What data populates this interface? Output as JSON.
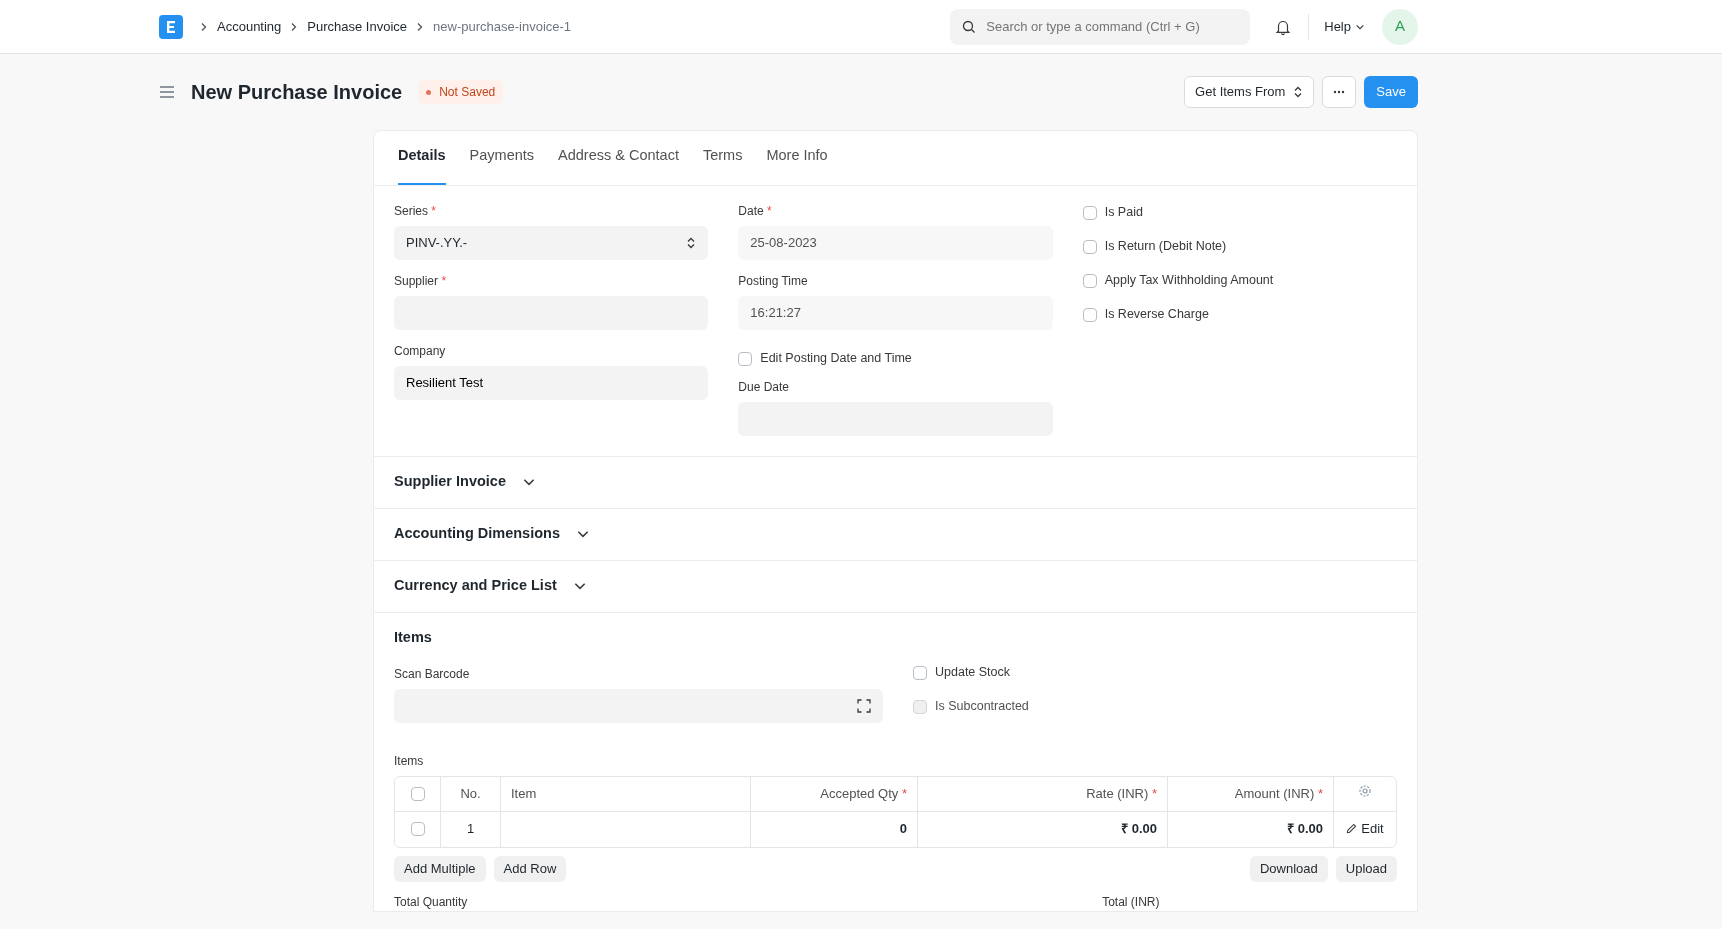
{
  "navbar": {
    "breadcrumbs": [
      "Accounting",
      "Purchase Invoice",
      "new-purchase-invoice-1"
    ],
    "search": {
      "placeholder": "Search or type a command (Ctrl + G)"
    },
    "help": "Help",
    "avatar": "A"
  },
  "page": {
    "title": "New Purchase Invoice",
    "indicator": {
      "label": "Not Saved",
      "color": "#e2725b"
    },
    "get_items": "Get Items From",
    "save": "Save"
  },
  "tabs": [
    {
      "label": "Details",
      "selected": true
    },
    {
      "label": "Payments",
      "selected": false
    },
    {
      "label": "Address & Contact",
      "selected": false
    },
    {
      "label": "Terms",
      "selected": false
    },
    {
      "label": "More Info",
      "selected": false
    }
  ],
  "columns": [
    [
      {
        "kind": "select",
        "label": "Series",
        "required_mark": "*",
        "value": "PINV-.YY.-"
      },
      {
        "kind": "input",
        "label": "Supplier",
        "required_mark": "*"
      },
      {
        "kind": "input",
        "label": "Company",
        "value": "Resilient Test"
      }
    ],
    [
      {
        "kind": "readonly",
        "label": "Date",
        "required_mark": "*",
        "value": "25-08-2023"
      },
      {
        "kind": "readonly",
        "label": "Posting Time",
        "value": "16:21:27"
      },
      {
        "kind": "checkbox",
        "label": "Edit Posting Date and Time",
        "checked": false,
        "disabled": false
      },
      {
        "kind": "input",
        "label": "Due Date"
      }
    ],
    [
      {
        "kind": "checkbox",
        "label": "Is Paid",
        "checked": false,
        "disabled": false
      },
      {
        "kind": "checkbox",
        "label": "Is Return (Debit Note)",
        "checked": false,
        "disabled": false
      },
      {
        "kind": "checkbox",
        "label": "Apply Tax Withholding Amount",
        "checked": false,
        "disabled": false
      },
      {
        "kind": "checkbox",
        "label": "Is Reverse Charge",
        "checked": false,
        "disabled": false
      }
    ]
  ],
  "sections": [
    {
      "title": "Supplier Invoice",
      "expanded": false
    },
    {
      "title": "Accounting Dimensions",
      "expanded": false
    },
    {
      "title": "Currency and Price List",
      "expanded": false
    }
  ],
  "items_section": {
    "title": "Items",
    "scan_barcode": {
      "label": "Scan Barcode"
    },
    "checkboxes": [
      {
        "label": "Update Stock",
        "checked": false,
        "disabled": false
      },
      {
        "label": "Is Subcontracted",
        "checked": false,
        "disabled": true
      }
    ],
    "table": {
      "label": "Items",
      "select_all": {
        "checked": false
      },
      "columns": [
        {
          "label": "No."
        },
        {
          "label": "Item"
        },
        {
          "label": "Accepted Qty",
          "required_mark": "*"
        },
        {
          "label": "Rate (INR)",
          "required_mark": "*"
        },
        {
          "label": "Amount (INR)",
          "required_mark": "*"
        }
      ],
      "rows": [
        {
          "no": "1",
          "qty": "0",
          "rate": "₹ 0.00",
          "amount": "₹ 0.00",
          "selected": false,
          "edit": "Edit"
        }
      ],
      "left_buttons": [
        "Add Multiple",
        "Add Row"
      ],
      "right_buttons": [
        "Download",
        "Upload"
      ]
    },
    "totals": [
      "Total Quantity",
      "Total (INR)"
    ]
  }
}
